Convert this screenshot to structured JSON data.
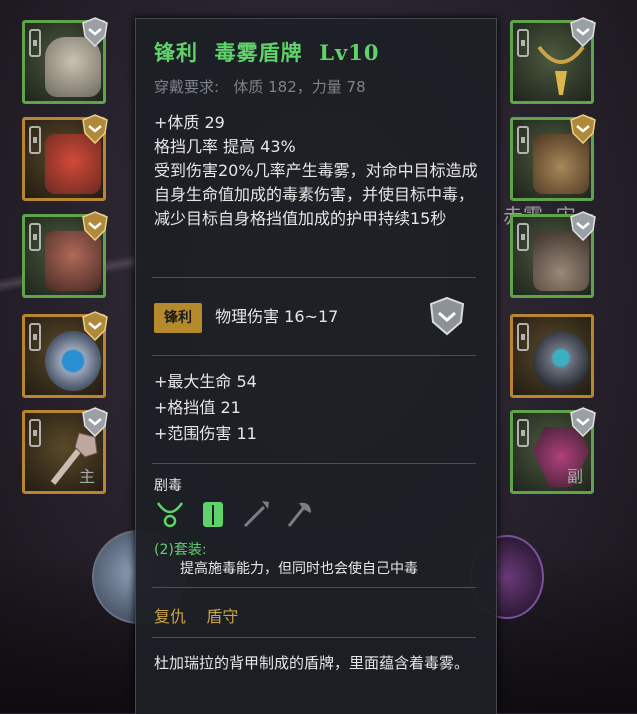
{
  "item": {
    "name_prefix": "锋利",
    "name": "毒雾盾牌",
    "level": "Lv10",
    "requirement_label": "穿戴要求:",
    "requirement_values": "体质 182，力量 78"
  },
  "base_stats": [
    "+体质 29",
    "格挡几率  提高 43%",
    "受到伤害20%几率产生毒雾，对命中目标造成自身生命值加成的毒素伤害，并使目标中毒，减少目标自身格挡值加成的护甲持续15秒"
  ],
  "affix": {
    "chip_label": "锋利",
    "text": "物理伤害 16~17"
  },
  "bonus_stats": [
    "+最大生命  54",
    "+格挡值  21",
    "+范围伤害  11"
  ],
  "set": {
    "name": "剧毒",
    "icons": [
      "necklace-icon",
      "armor-icon",
      "spear-icon",
      "axe-icon"
    ],
    "bonus_label": "(2)套装:",
    "bonus_text": "提高施毒能力，但同时也会使自己中毒"
  },
  "skills": [
    "复仇",
    "盾守"
  ],
  "flavor": "杜加瑞拉的背甲制成的盾牌，里面蕴含着毒雾。",
  "left_slots": [
    {
      "name": "helmet-slot",
      "tag": ""
    },
    {
      "name": "armor-slot",
      "tag": ""
    },
    {
      "name": "cloak-slot",
      "tag": ""
    },
    {
      "name": "ring-slot",
      "tag": ""
    },
    {
      "name": "weapon-slot",
      "tag": "主"
    }
  ],
  "right_slots": [
    {
      "name": "amulet-slot",
      "tag": ""
    },
    {
      "name": "gloves-slot",
      "tag": ""
    },
    {
      "name": "boots-slot",
      "tag": ""
    },
    {
      "name": "ring2-slot",
      "tag": ""
    },
    {
      "name": "shield-slot",
      "tag": "副"
    }
  ],
  "background_text": "赤雾  宋，",
  "colors": {
    "rarity_green": "#5fd36a",
    "gold": "#c9a24a",
    "panel": "#1c1f24"
  }
}
